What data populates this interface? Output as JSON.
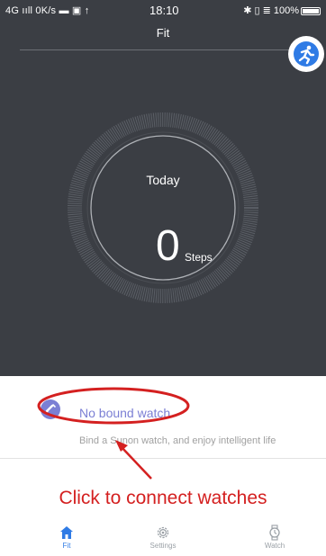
{
  "status_bar": {
    "left": "4G ııll 0K/s ▬ ▣ ↑",
    "time": "18:10",
    "right": "✱ ▯ ≣ 100%"
  },
  "header": {
    "title": "Fit"
  },
  "summary": {
    "day_label": "Today",
    "steps_value": "0",
    "steps_unit": "Steps"
  },
  "bind_watch": {
    "title": "No bound watch",
    "subtitle": "Bind a Sunon watch, and enjoy intelligent life"
  },
  "annotation": {
    "text": "Click to connect watches"
  },
  "tabs": [
    {
      "label": "Fit",
      "active": true
    },
    {
      "label": "Settings",
      "active": false
    },
    {
      "label": "Watch",
      "active": false
    }
  ],
  "colors": {
    "header_bg": "#3b3e44",
    "accent": "#2f7be5",
    "watch_accent": "#7b7fd4",
    "annotation": "#d42020"
  }
}
